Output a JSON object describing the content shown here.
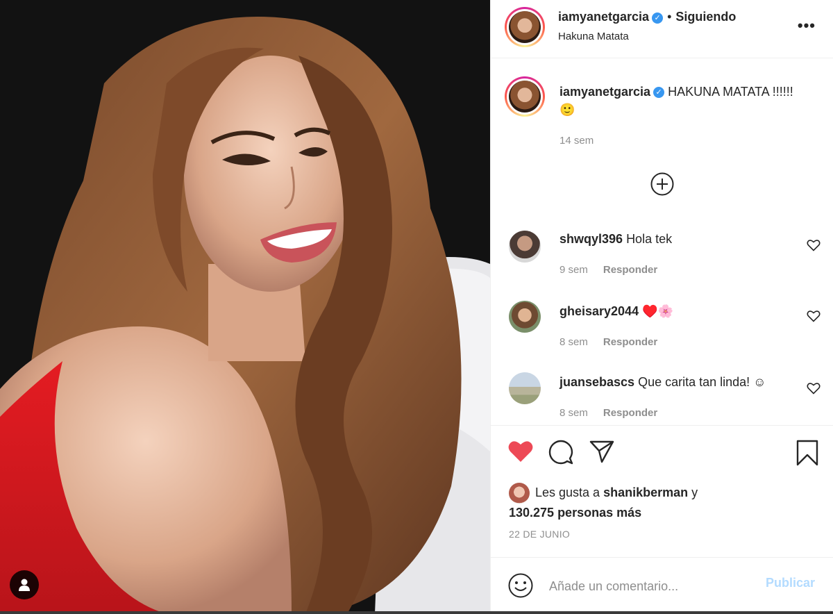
{
  "post": {
    "username": "iamyanetgarcia",
    "verified_mark": "✓",
    "separator": "•",
    "follow_status": "Siguiendo",
    "location": "Hakuna Matata",
    "more_label": "•••"
  },
  "caption": {
    "username": "iamyanetgarcia",
    "text": "HAKUNA MATATA !!!!!! 🙂",
    "time": "14 sem"
  },
  "comments": [
    {
      "username": "shwqyl396",
      "text": "Hola tek",
      "time": "9 sem",
      "reply": "Responder"
    },
    {
      "username": "gheisary2044",
      "text": "♥️🌸",
      "time": "8 sem",
      "reply": "Responder"
    },
    {
      "username": "juansebascs",
      "text": "Que carita tan linda! ☺",
      "time": "8 sem",
      "reply": "Responder"
    }
  ],
  "likes": {
    "prefix": "Les gusta a",
    "user": "shanikberman",
    "joiner": "y",
    "count": "130.275 personas más"
  },
  "date": "22 DE JUNIO",
  "composer": {
    "placeholder": "Añade un comentario...",
    "publish": "Publicar"
  },
  "icons": {
    "like": "heart-filled-icon",
    "comment": "comment-icon",
    "share": "paper-plane-icon",
    "save": "bookmark-icon",
    "emoji": "emoji-icon",
    "tag": "user-tag-icon",
    "load_more": "plus-circle-icon"
  },
  "colors": {
    "like_red": "#ed4956",
    "verified_blue": "#3897f0",
    "publish_disabled": "#b3dbff",
    "muted_text": "#8e8e8e"
  }
}
